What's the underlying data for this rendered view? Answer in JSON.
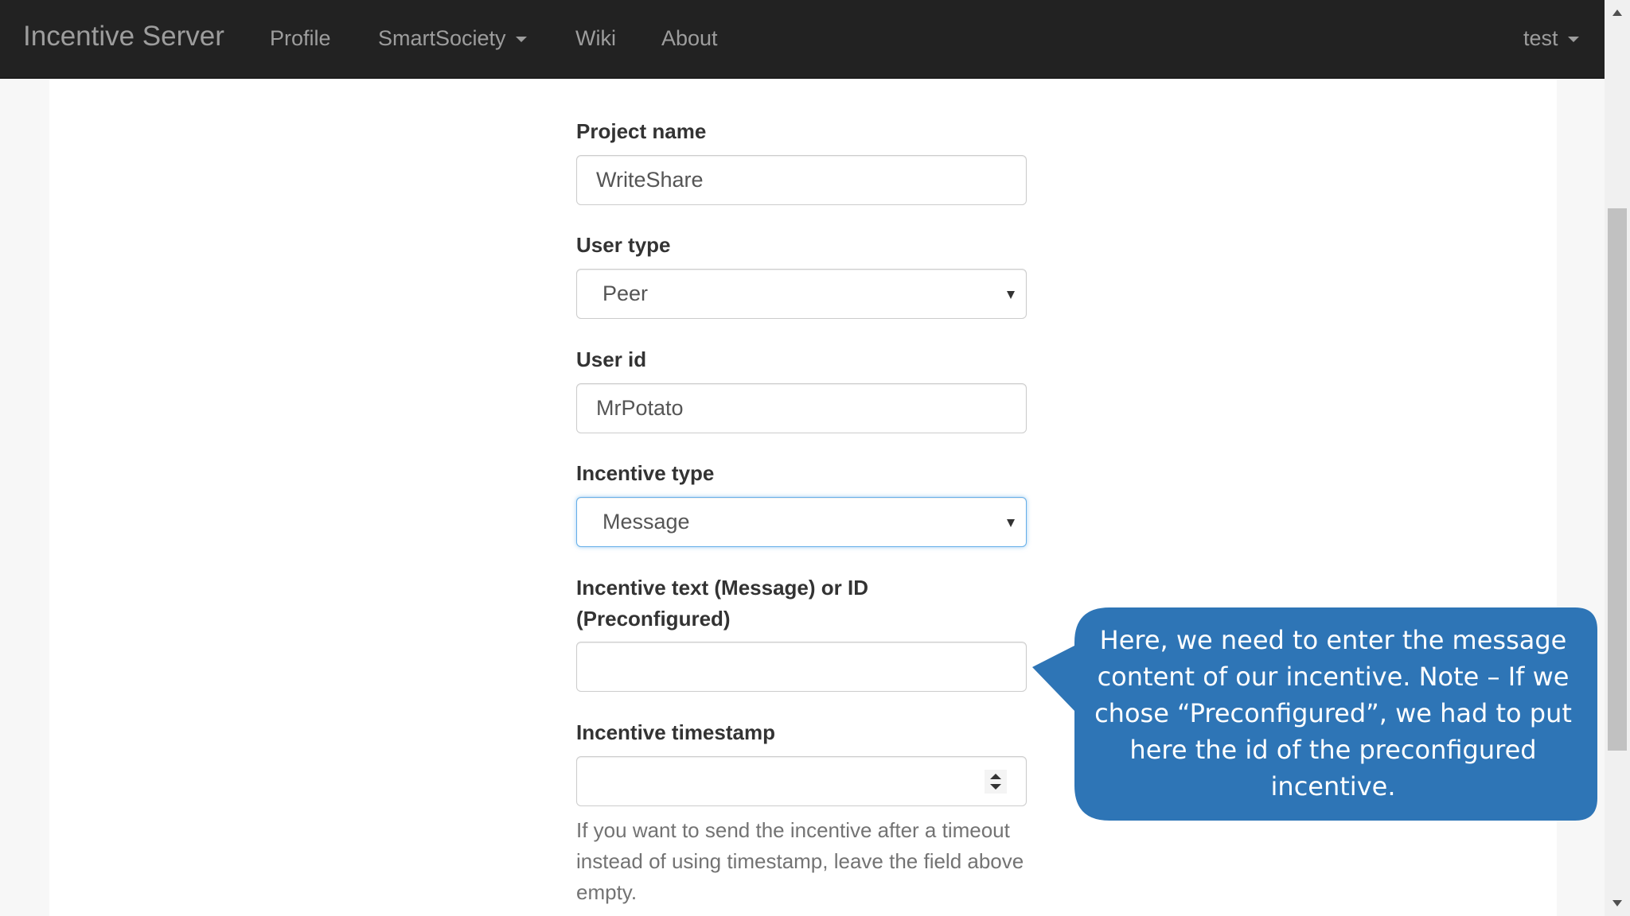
{
  "navbar": {
    "brand": "Incentive Server",
    "links": {
      "profile": "Profile",
      "smartsociety": "SmartSociety",
      "wiki": "Wiki",
      "about": "About"
    },
    "user": "test"
  },
  "form": {
    "project_name": {
      "label": "Project name",
      "value": "WriteShare"
    },
    "user_type": {
      "label": "User type",
      "value": "Peer"
    },
    "user_id": {
      "label": "User id",
      "value": "MrPotato"
    },
    "incentive_type": {
      "label": "Incentive type",
      "value": "Message"
    },
    "incentive_text": {
      "label": "Incentive text (Message) or ID (Preconfigured)",
      "value": ""
    },
    "incentive_timestamp": {
      "label": "Incentive timestamp",
      "value": "",
      "help": "If you want to send the incentive after a timeout instead of using timestamp, leave the field above empty."
    }
  },
  "callout": {
    "text": "Here, we need to enter the message content of our incentive. Note – If we chose “Preconfigured”, we had to put here the id of the preconfigured incentive.",
    "color": "#2e75b6"
  },
  "colors": {
    "navbar_bg": "#222222",
    "nav_text": "#9d9d9d",
    "focus_border": "#66afe9"
  }
}
